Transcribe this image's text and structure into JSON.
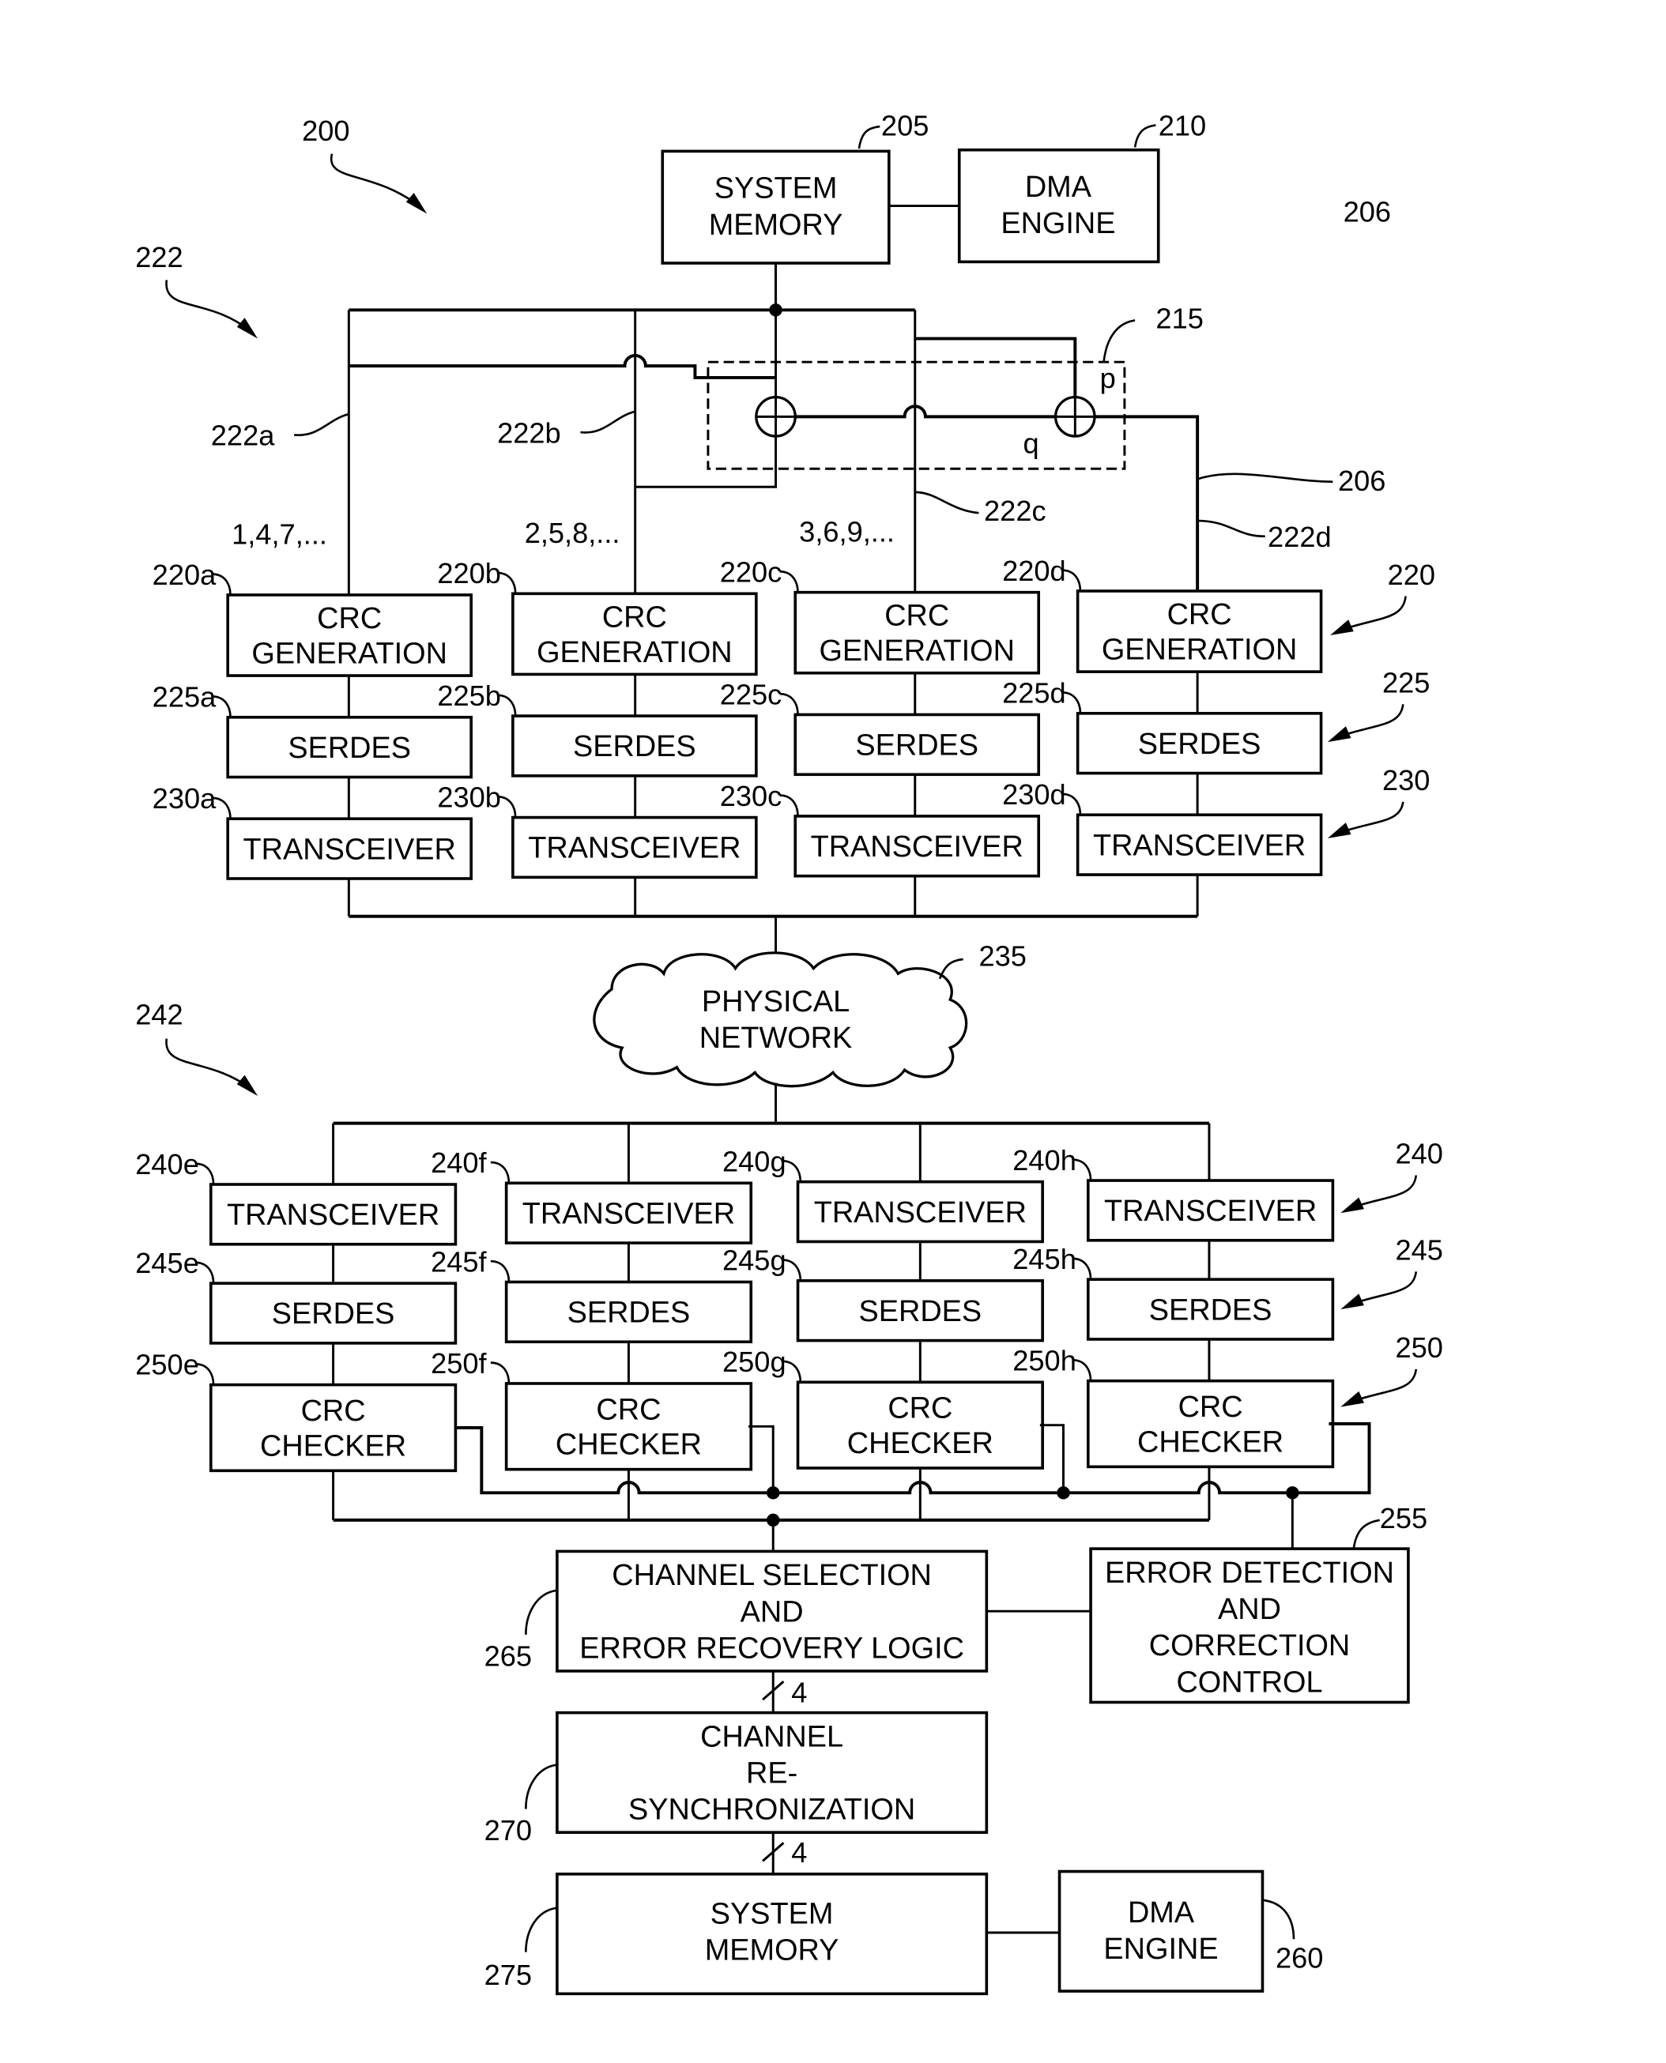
{
  "figure": {
    "ref": "200",
    "transmit_group_ref": "222",
    "receive_group_ref": "242",
    "corner_ref": "206"
  },
  "transmit": {
    "system_memory": {
      "ref": "205",
      "lines": [
        "SYSTEM",
        "MEMORY"
      ]
    },
    "dma_engine": {
      "ref": "210",
      "lines": [
        "DMA",
        "ENGINE"
      ]
    },
    "parity": {
      "ref": "215",
      "p_label": "p",
      "q_label": "q"
    },
    "link_refs": {
      "a": "222a",
      "b": "222b",
      "c": "222c",
      "d": "222d",
      "parity_link": "206"
    },
    "sequences": [
      "1,4,7,...",
      "2,5,8,...",
      "3,6,9,..."
    ],
    "crc_gen": {
      "group_ref": "220",
      "lines": [
        "CRC",
        "GENERATION"
      ],
      "refs": [
        "220a",
        "220b",
        "220c",
        "220d"
      ]
    },
    "serdes": {
      "group_ref": "225",
      "label": "SERDES",
      "refs": [
        "225a",
        "225b",
        "225c",
        "225d"
      ]
    },
    "transceiver": {
      "group_ref": "230",
      "label": "TRANSCEIVER",
      "refs": [
        "230a",
        "230b",
        "230c",
        "230d"
      ]
    }
  },
  "network": {
    "ref": "235",
    "lines": [
      "PHYSICAL",
      "NETWORK"
    ]
  },
  "receive": {
    "transceiver": {
      "group_ref": "240",
      "label": "TRANSCEIVER",
      "refs": [
        "240e",
        "240f",
        "240g",
        "240h"
      ]
    },
    "serdes": {
      "group_ref": "245",
      "label": "SERDES",
      "refs": [
        "245e",
        "245f",
        "245g",
        "245h"
      ]
    },
    "crc_checker": {
      "group_ref": "250",
      "lines": [
        "CRC",
        "CHECKER"
      ],
      "refs": [
        "250e",
        "250f",
        "250g",
        "250h"
      ]
    },
    "error_control": {
      "ref": "255",
      "lines": [
        "ERROR DETECTION",
        "AND",
        "CORRECTION",
        "CONTROL"
      ]
    },
    "channel_selection": {
      "ref": "265",
      "lines": [
        "CHANNEL SELECTION",
        "AND",
        "ERROR RECOVERY LOGIC"
      ]
    },
    "bus_width_1": "4",
    "resync": {
      "ref": "270",
      "lines": [
        "CHANNEL",
        "RE-",
        "SYNCHRONIZATION"
      ]
    },
    "bus_width_2": "4",
    "system_memory": {
      "ref": "275",
      "lines": [
        "SYSTEM",
        "MEMORY"
      ]
    },
    "dma_engine": {
      "ref": "260",
      "lines": [
        "DMA",
        "ENGINE"
      ]
    }
  }
}
